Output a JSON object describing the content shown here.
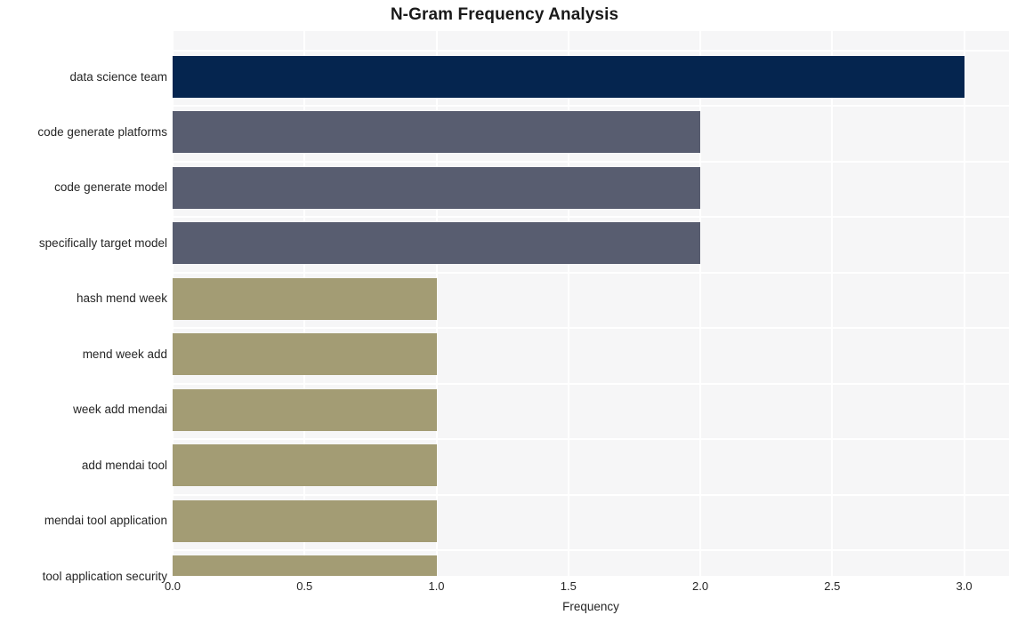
{
  "chart_data": {
    "type": "bar",
    "orientation": "horizontal",
    "title": "N-Gram Frequency Analysis",
    "xlabel": "Frequency",
    "ylabel": "",
    "categories": [
      "data science team",
      "code generate platforms",
      "code generate model",
      "specifically target model",
      "hash mend week",
      "mend week add",
      "week add mendai",
      "add mendai tool",
      "mendai tool application",
      "tool application security"
    ],
    "values": [
      3,
      2,
      2,
      2,
      1,
      1,
      1,
      1,
      1,
      1
    ],
    "bar_colors": [
      "#05254f",
      "#585d70",
      "#585d70",
      "#585d70",
      "#a39c74",
      "#a39c74",
      "#a39c74",
      "#a39c74",
      "#a39c74",
      "#a39c74"
    ],
    "xlim": [
      0,
      3.17
    ],
    "xticks": [
      0.0,
      0.5,
      1.0,
      1.5,
      2.0,
      2.5,
      3.0
    ],
    "xtick_labels": [
      "0.0",
      "0.5",
      "1.0",
      "1.5",
      "2.0",
      "2.5",
      "3.0"
    ],
    "grid": true,
    "grid_color": "#ffffff",
    "plot_background": "#f6f6f7",
    "figure_background": "#ffffff",
    "legend": null
  }
}
